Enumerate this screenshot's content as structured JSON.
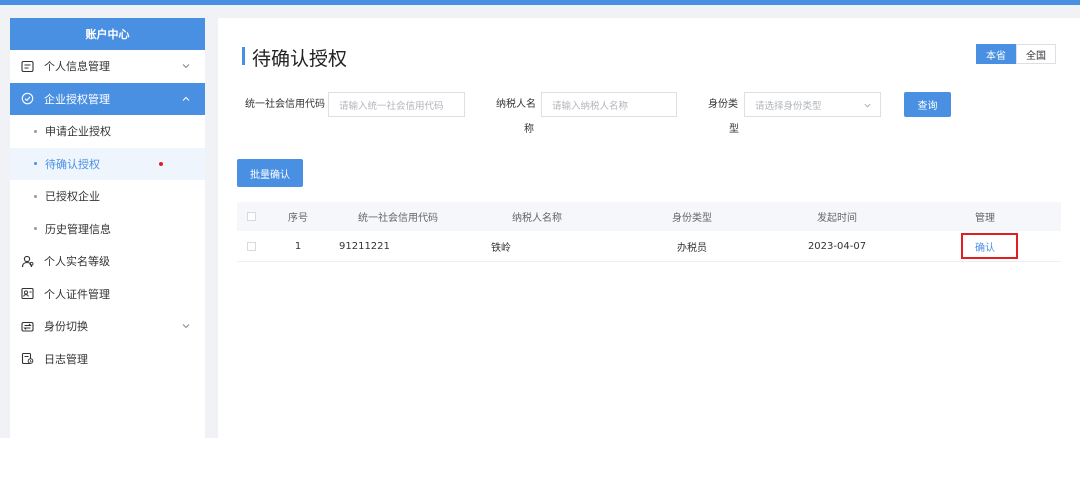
{
  "sidebar": {
    "header": "账户中心",
    "items": [
      {
        "label": "个人信息管理"
      },
      {
        "label": "企业授权管理"
      },
      {
        "label": "个人实名等级"
      },
      {
        "label": "个人证件管理"
      },
      {
        "label": "身份切换"
      },
      {
        "label": "日志管理"
      }
    ],
    "sub_items": [
      {
        "label": "申请企业授权"
      },
      {
        "label": "待确认授权"
      },
      {
        "label": "已授权企业"
      },
      {
        "label": "历史管理信息"
      }
    ]
  },
  "main": {
    "title": "待确认授权",
    "scope": {
      "current": "本省",
      "all": "全国"
    },
    "filters": {
      "credit_code_label": "统一社会信用代码",
      "credit_code_placeholder": "请输入统一社会信用代码",
      "taxpayer_label_line1": "纳税人名",
      "taxpayer_label_line2": "称",
      "taxpayer_placeholder": "请输入纳税人名称",
      "identity_label_line1": "身份类",
      "identity_label_line2": "型",
      "identity_placeholder": "请选择身份类型",
      "query_button": "查询"
    },
    "batch_button": "批量确认",
    "table": {
      "columns": [
        "序号",
        "统一社会信用代码",
        "纳税人名称",
        "身份类型",
        "发起时间",
        "管理"
      ],
      "rows": [
        {
          "index": "1",
          "credit_code": "91211221",
          "taxpayer": "铁岭",
          "identity": "办税员",
          "date": "2023-04-07",
          "action": "确认"
        }
      ]
    }
  }
}
